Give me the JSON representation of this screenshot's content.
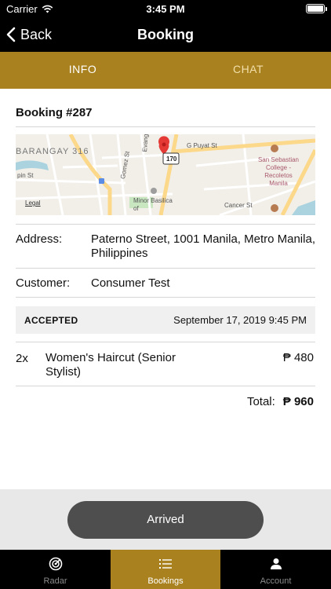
{
  "status_bar": {
    "carrier": "Carrier",
    "time": "3:45 PM"
  },
  "nav": {
    "back_label": "Back",
    "title": "Booking"
  },
  "tabs": [
    {
      "label": "INFO",
      "active": true
    },
    {
      "label": "CHAT",
      "active": false
    }
  ],
  "booking": {
    "title": "Booking #287",
    "address_label": "Address:",
    "address_value": "Paterno Street, 1001 Manila, Metro Manila, Philippines",
    "customer_label": "Customer:",
    "customer_value": "Consumer Test",
    "status": "ACCEPTED",
    "date": "September 17, 2019 9:45 PM",
    "items": [
      {
        "qty": "2x",
        "name": "Women's Haircut (Senior Stylist)",
        "price": "₱ 480"
      }
    ],
    "total_label": "Total:",
    "total_value": "₱ 960"
  },
  "map": {
    "labels": {
      "barangay": "BARANGAY 316",
      "puyat": "G Puyat St",
      "evangelista": "Evangelista St",
      "gomez": "Gomez St",
      "route": "170",
      "college": "San Sebastian College - Recoletos Manila",
      "minor": "Minor Basilica of",
      "cancer": "Cancer St",
      "legal": "Legal",
      "pin": "pin St"
    }
  },
  "action": {
    "arrived_label": "Arrived"
  },
  "tab_bar": [
    {
      "label": "Radar",
      "icon": "radar-icon",
      "active": false
    },
    {
      "label": "Bookings",
      "icon": "list-icon",
      "active": true
    },
    {
      "label": "Account",
      "icon": "person-icon",
      "active": false
    }
  ],
  "colors": {
    "accent": "#a9821f",
    "button": "#4e4e4e",
    "status_strip": "#f0f0f0"
  }
}
